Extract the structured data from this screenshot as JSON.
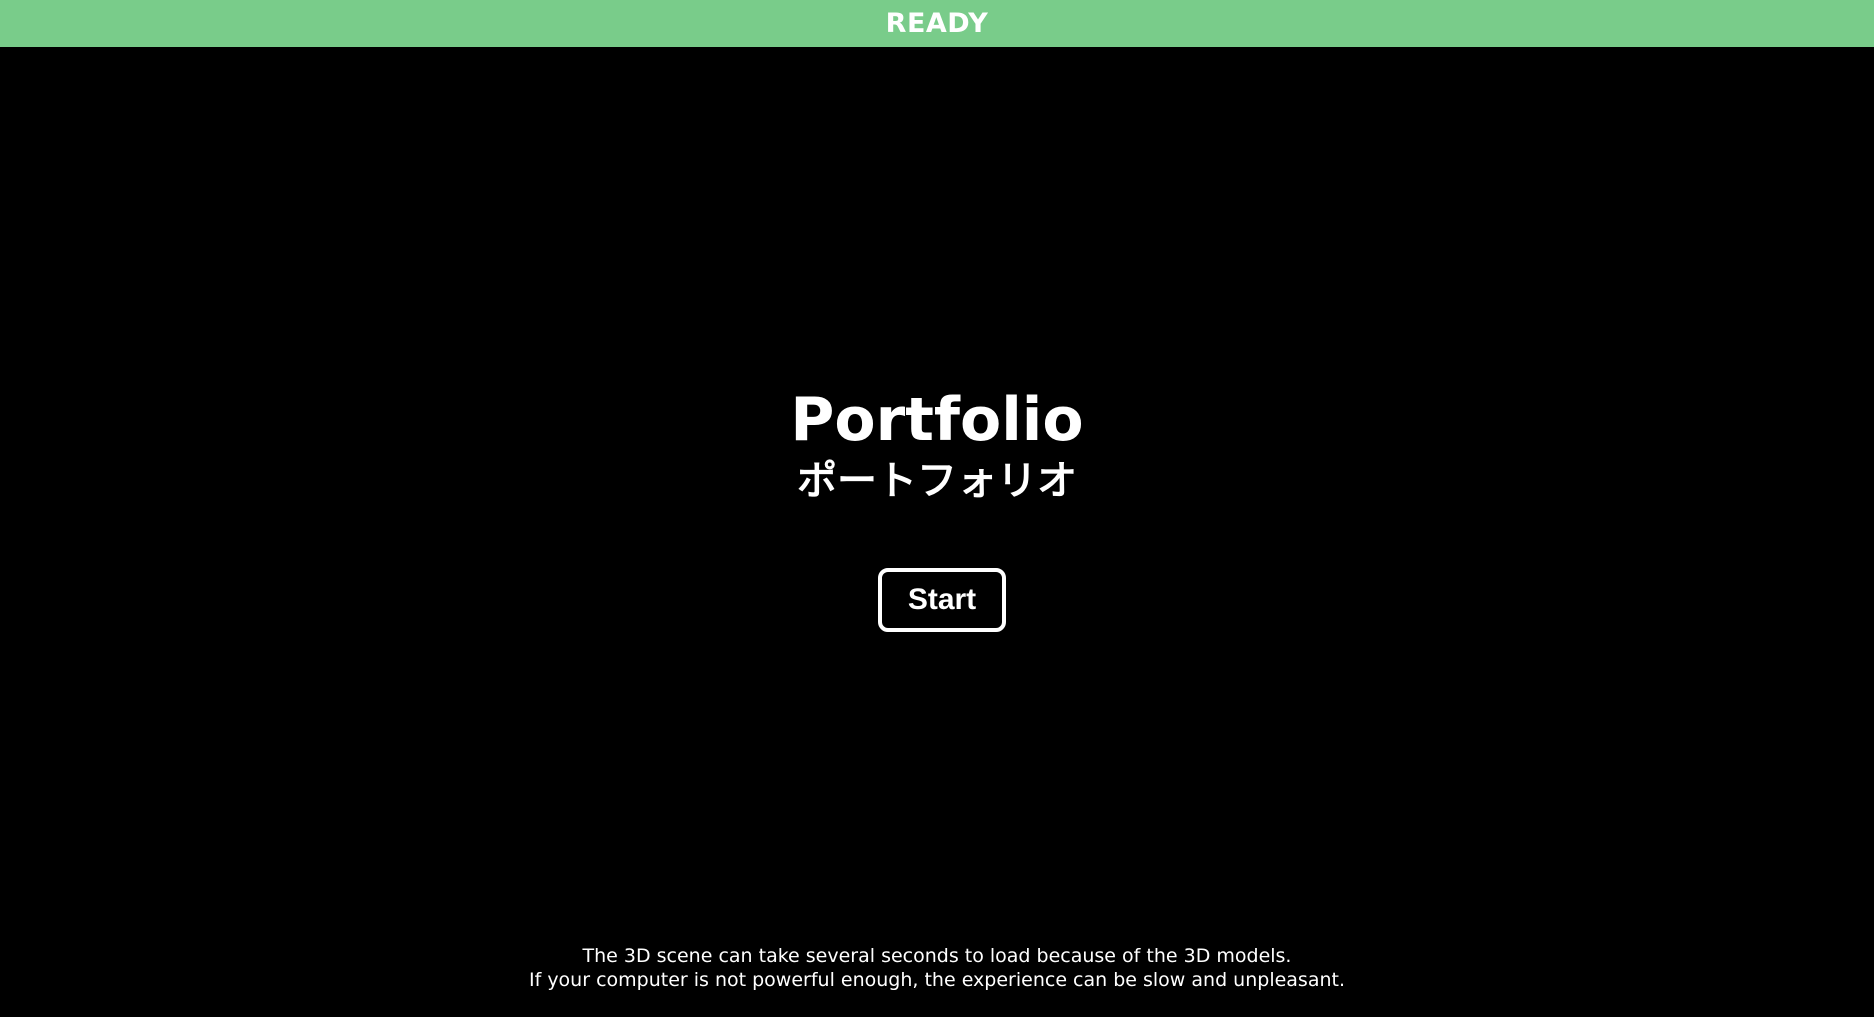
{
  "status_bar": {
    "label": "READY",
    "color": "#79cc8a"
  },
  "hero": {
    "title": "Portfolio",
    "subtitle": "ポートフォリオ"
  },
  "start_button": {
    "label": "Start"
  },
  "notice": {
    "line1": "The 3D scene can take several seconds to load because of the 3D models.",
    "line2": "If your computer is not powerful enough, the experience can be slow and unpleasant."
  },
  "colors": {
    "background": "#000000",
    "text": "#ffffff"
  }
}
